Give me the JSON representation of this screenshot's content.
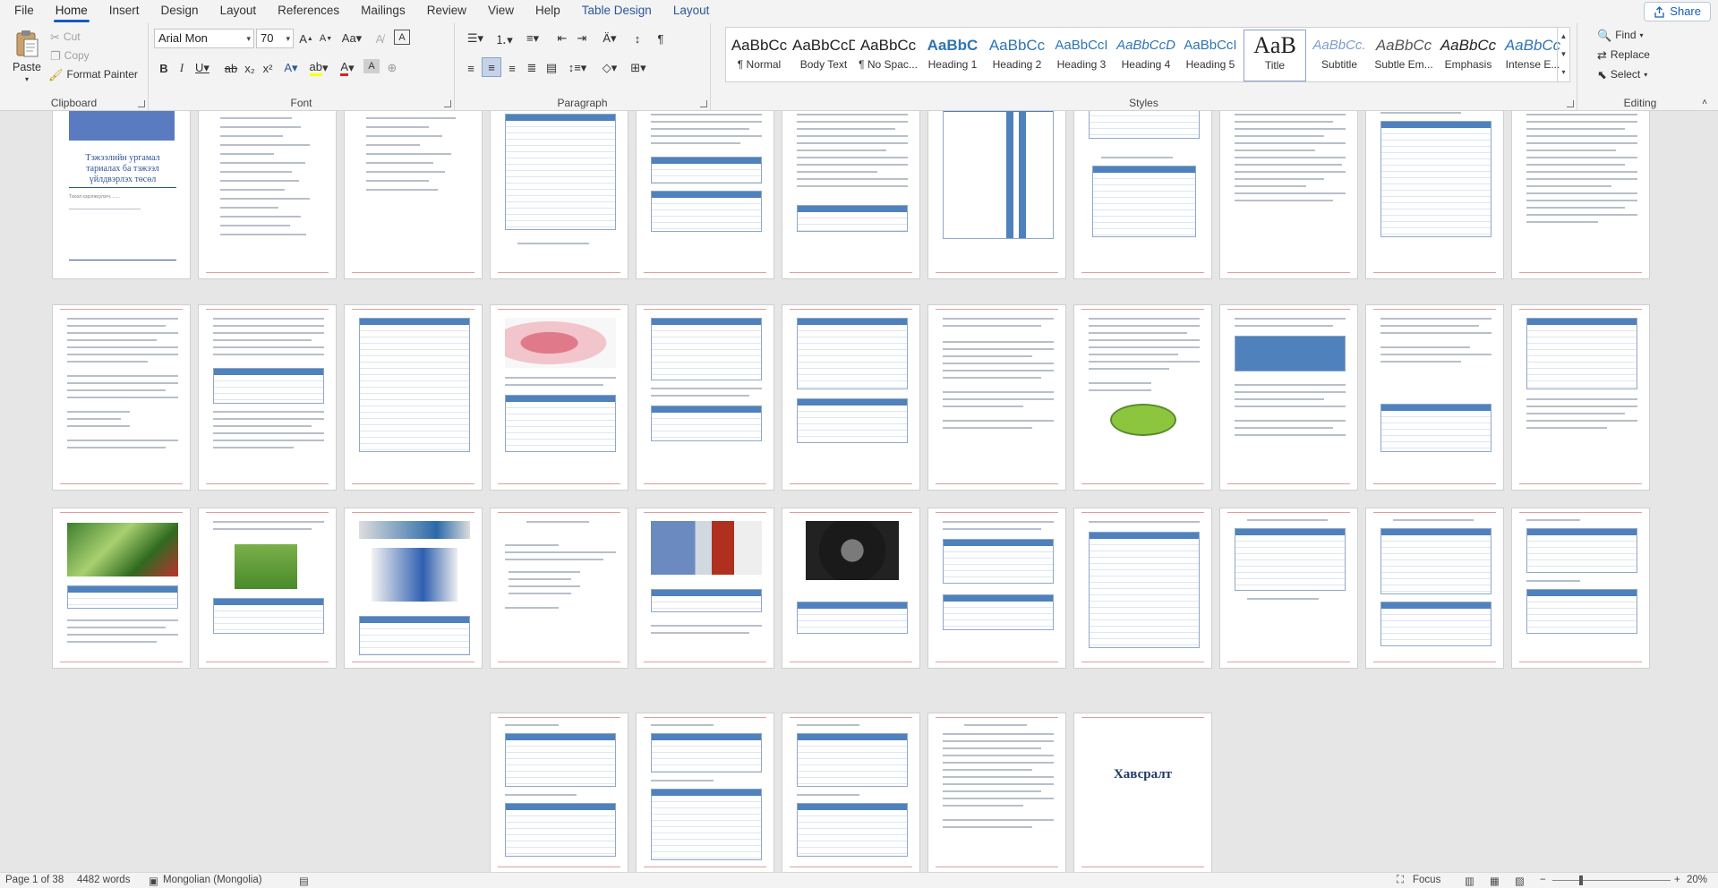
{
  "tabs": [
    "File",
    "Home",
    "Insert",
    "Design",
    "Layout",
    "References",
    "Mailings",
    "Review",
    "View",
    "Help",
    "Table Design",
    "Layout"
  ],
  "share": "Share",
  "clipboard": {
    "paste": "Paste",
    "cut": "Cut",
    "copy": "Copy",
    "format_painter": "Format Painter",
    "label": "Clipboard"
  },
  "font": {
    "family": "Arial Mon",
    "size": "70",
    "label": "Font"
  },
  "paragraph": {
    "label": "Paragraph"
  },
  "styles": {
    "label": "Styles",
    "items": [
      {
        "preview": "AaBbCc",
        "name": "¶ Normal"
      },
      {
        "preview": "AaBbCcD",
        "name": "Body Text"
      },
      {
        "preview": "AaBbCc",
        "name": "¶ No Spac..."
      },
      {
        "preview": "AaBbC",
        "name": "Heading 1"
      },
      {
        "preview": "AaBbCc",
        "name": "Heading 2"
      },
      {
        "preview": "AaBbCcI",
        "name": "Heading 3"
      },
      {
        "preview": "AaBbCcD",
        "name": "Heading 4"
      },
      {
        "preview": "AaBbCcI",
        "name": "Heading 5"
      },
      {
        "preview": "AaB",
        "name": "Title"
      },
      {
        "preview": "AaBbCc.",
        "name": "Subtitle"
      },
      {
        "preview": "AaBbCc",
        "name": "Subtle Em..."
      },
      {
        "preview": "AaBbCc",
        "name": "Emphasis"
      },
      {
        "preview": "AaBbCc",
        "name": "Intense E..."
      }
    ]
  },
  "editing": {
    "label": "Editing",
    "find": "Find",
    "replace": "Replace",
    "select": "Select"
  },
  "document": {
    "cover_title": "Тэжээлийн ургамал тариалах ба тэжээл үйлдвэрлэх төсөл",
    "cover_subtitle": "Төсөл хэрэгжүүлэгч........",
    "appendix_title": "Хавсралт"
  },
  "status": {
    "page": "Page 1 of 38",
    "words": "4482 words",
    "language": "Mongolian (Mongolia)",
    "focus": "Focus",
    "zoom": "20%"
  }
}
